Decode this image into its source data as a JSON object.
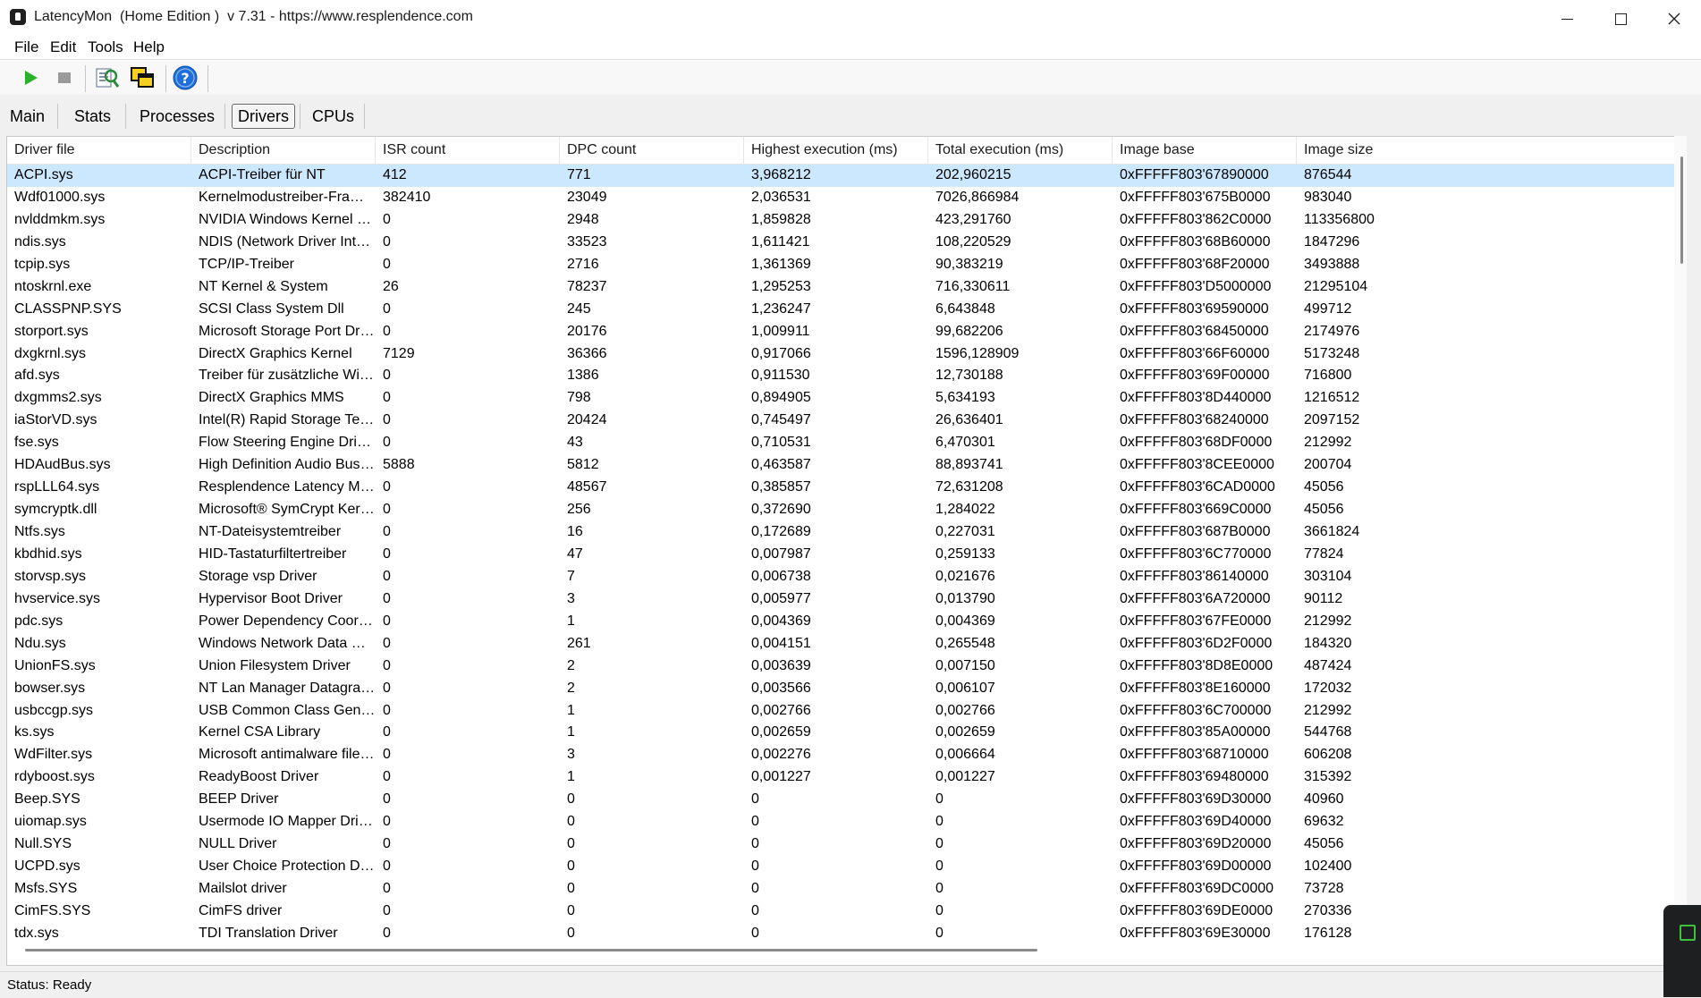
{
  "window": {
    "title": "LatencyMon  (Home Edition )  v 7.31 - https://www.resplendence.com"
  },
  "menu": {
    "file": "File",
    "edit": "Edit",
    "tools": "Tools",
    "help": "Help"
  },
  "toolbar": {
    "icons": [
      "play-icon",
      "stop-icon",
      "report-icon",
      "windows-icon",
      "help-icon"
    ]
  },
  "tabs": {
    "main": "Main",
    "stats": "Stats",
    "processes": "Processes",
    "drivers": "Drivers",
    "cpus": "CPUs",
    "active": "Drivers"
  },
  "table": {
    "columns": [
      "Driver file",
      "Description",
      "ISR count",
      "DPC count",
      "Highest execution (ms)",
      "Total execution (ms)",
      "Image base",
      "Image size"
    ],
    "rows": [
      [
        "ACPI.sys",
        "ACPI-Treiber für NT",
        "412",
        "771",
        "3,968212",
        "202,960215",
        "0xFFFFF803'67890000",
        "876544"
      ],
      [
        "Wdf01000.sys",
        "Kernelmodustreiber-Framewor...",
        "382410",
        "23049",
        "2,036531",
        "7026,866984",
        "0xFFFFF803'675B0000",
        "983040"
      ],
      [
        "nvlddmkm.sys",
        "NVIDIA Windows Kernel Mod...",
        "0",
        "2948",
        "1,859828",
        "423,291760",
        "0xFFFFF803'862C0000",
        "113356800"
      ],
      [
        "ndis.sys",
        "NDIS (Network Driver Interface...",
        "0",
        "33523",
        "1,611421",
        "108,220529",
        "0xFFFFF803'68B60000",
        "1847296"
      ],
      [
        "tcpip.sys",
        "TCP/IP-Treiber",
        "0",
        "2716",
        "1,361369",
        "90,383219",
        "0xFFFFF803'68F20000",
        "3493888"
      ],
      [
        "ntoskrnl.exe",
        "NT Kernel & System",
        "26",
        "78237",
        "1,295253",
        "716,330611",
        "0xFFFFF803'D5000000",
        "21295104"
      ],
      [
        "CLASSPNP.SYS",
        "SCSI Class System Dll",
        "0",
        "245",
        "1,236247",
        "6,643848",
        "0xFFFFF803'69590000",
        "499712"
      ],
      [
        "storport.sys",
        "Microsoft Storage Port Driver",
        "0",
        "20176",
        "1,009911",
        "99,682206",
        "0xFFFFF803'68450000",
        "2174976"
      ],
      [
        "dxgkrnl.sys",
        "DirectX Graphics Kernel",
        "7129",
        "36366",
        "0,917066",
        "1596,128909",
        "0xFFFFF803'66F60000",
        "5173248"
      ],
      [
        "afd.sys",
        "Treiber für zusätzliche WinSo...",
        "0",
        "1386",
        "0,911530",
        "12,730188",
        "0xFFFFF803'69F00000",
        "716800"
      ],
      [
        "dxgmms2.sys",
        "DirectX Graphics MMS",
        "0",
        "798",
        "0,894905",
        "5,634193",
        "0xFFFFF803'8D440000",
        "1216512"
      ],
      [
        "iaStorVD.sys",
        "Intel(R) Rapid Storage Techno...",
        "0",
        "20424",
        "0,745497",
        "26,636401",
        "0xFFFFF803'68240000",
        "2097152"
      ],
      [
        "fse.sys",
        "Flow Steering Engine Driver",
        "0",
        "43",
        "0,710531",
        "6,470301",
        "0xFFFFF803'68DF0000",
        "212992"
      ],
      [
        "HDAudBus.sys",
        "High Definition Audio Bus Driver",
        "5888",
        "5812",
        "0,463587",
        "88,893741",
        "0xFFFFF803'8CEE0000",
        "200704"
      ],
      [
        "rspLLL64.sys",
        "Resplendence Latency Monit...",
        "0",
        "48567",
        "0,385857",
        "72,631208",
        "0xFFFFF803'6CAD0000",
        "45056"
      ],
      [
        "symcryptk.dll",
        "Microsoft® SymCrypt Kernel ...",
        "0",
        "256",
        "0,372690",
        "1,284022",
        "0xFFFFF803'669C0000",
        "45056"
      ],
      [
        "Ntfs.sys",
        "NT-Dateisystemtreiber",
        "0",
        "16",
        "0,172689",
        "0,227031",
        "0xFFFFF803'687B0000",
        "3661824"
      ],
      [
        "kbdhid.sys",
        "HID-Tastaturfiltertreiber",
        "0",
        "47",
        "0,007987",
        "0,259133",
        "0xFFFFF803'6C770000",
        "77824"
      ],
      [
        "storvsp.sys",
        "Storage vsp Driver",
        "0",
        "7",
        "0,006738",
        "0,021676",
        "0xFFFFF803'86140000",
        "303104"
      ],
      [
        "hvservice.sys",
        "Hypervisor Boot Driver",
        "0",
        "3",
        "0,005977",
        "0,013790",
        "0xFFFFF803'6A720000",
        "90112"
      ],
      [
        "pdc.sys",
        "Power Dependency Coordinat...",
        "0",
        "1",
        "0,004369",
        "0,004369",
        "0xFFFFF803'67FE0000",
        "212992"
      ],
      [
        "Ndu.sys",
        "Windows Network Data Usag...",
        "0",
        "261",
        "0,004151",
        "0,265548",
        "0xFFFFF803'6D2F0000",
        "184320"
      ],
      [
        "UnionFS.sys",
        "Union Filesystem Driver",
        "0",
        "2",
        "0,003639",
        "0,007150",
        "0xFFFFF803'8D8E0000",
        "487424"
      ],
      [
        "bowser.sys",
        "NT Lan Manager Datagram R...",
        "0",
        "2",
        "0,003566",
        "0,006107",
        "0xFFFFF803'8E160000",
        "172032"
      ],
      [
        "usbccgp.sys",
        "USB Common Class Generic ...",
        "0",
        "1",
        "0,002766",
        "0,002766",
        "0xFFFFF803'6C700000",
        "212992"
      ],
      [
        "ks.sys",
        "Kernel CSA Library",
        "0",
        "1",
        "0,002659",
        "0,002659",
        "0xFFFFF803'85A00000",
        "544768"
      ],
      [
        "WdFilter.sys",
        "Microsoft antimalware file sys...",
        "0",
        "3",
        "0,002276",
        "0,006664",
        "0xFFFFF803'68710000",
        "606208"
      ],
      [
        "rdyboost.sys",
        "ReadyBoost Driver",
        "0",
        "1",
        "0,001227",
        "0,001227",
        "0xFFFFF803'69480000",
        "315392"
      ],
      [
        "Beep.SYS",
        "BEEP Driver",
        "0",
        "0",
        "0",
        "0",
        "0xFFFFF803'69D30000",
        "40960"
      ],
      [
        "uiomap.sys",
        "Usermode IO Mapper Driver",
        "0",
        "0",
        "0",
        "0",
        "0xFFFFF803'69D40000",
        "69632"
      ],
      [
        "Null.SYS",
        "NULL Driver",
        "0",
        "0",
        "0",
        "0",
        "0xFFFFF803'69D20000",
        "45056"
      ],
      [
        "UCPD.sys",
        "User Choice Protection Driver",
        "0",
        "0",
        "0",
        "0",
        "0xFFFFF803'69D00000",
        "102400"
      ],
      [
        "Msfs.SYS",
        "Mailslot driver",
        "0",
        "0",
        "0",
        "0",
        "0xFFFFF803'69DC0000",
        "73728"
      ],
      [
        "CimFS.SYS",
        "CimFS driver",
        "0",
        "0",
        "0",
        "0",
        "0xFFFFF803'69DE0000",
        "270336"
      ],
      [
        "tdx.sys",
        "TDI Translation Driver",
        "0",
        "0",
        "0",
        "0",
        "0xFFFFF803'69E30000",
        "176128"
      ]
    ]
  },
  "status": {
    "text": "Status: Ready"
  },
  "colors": {
    "selected_row": "#cce8ff",
    "play_green": "#2bb02b",
    "help_blue": "#1e6fd9"
  }
}
